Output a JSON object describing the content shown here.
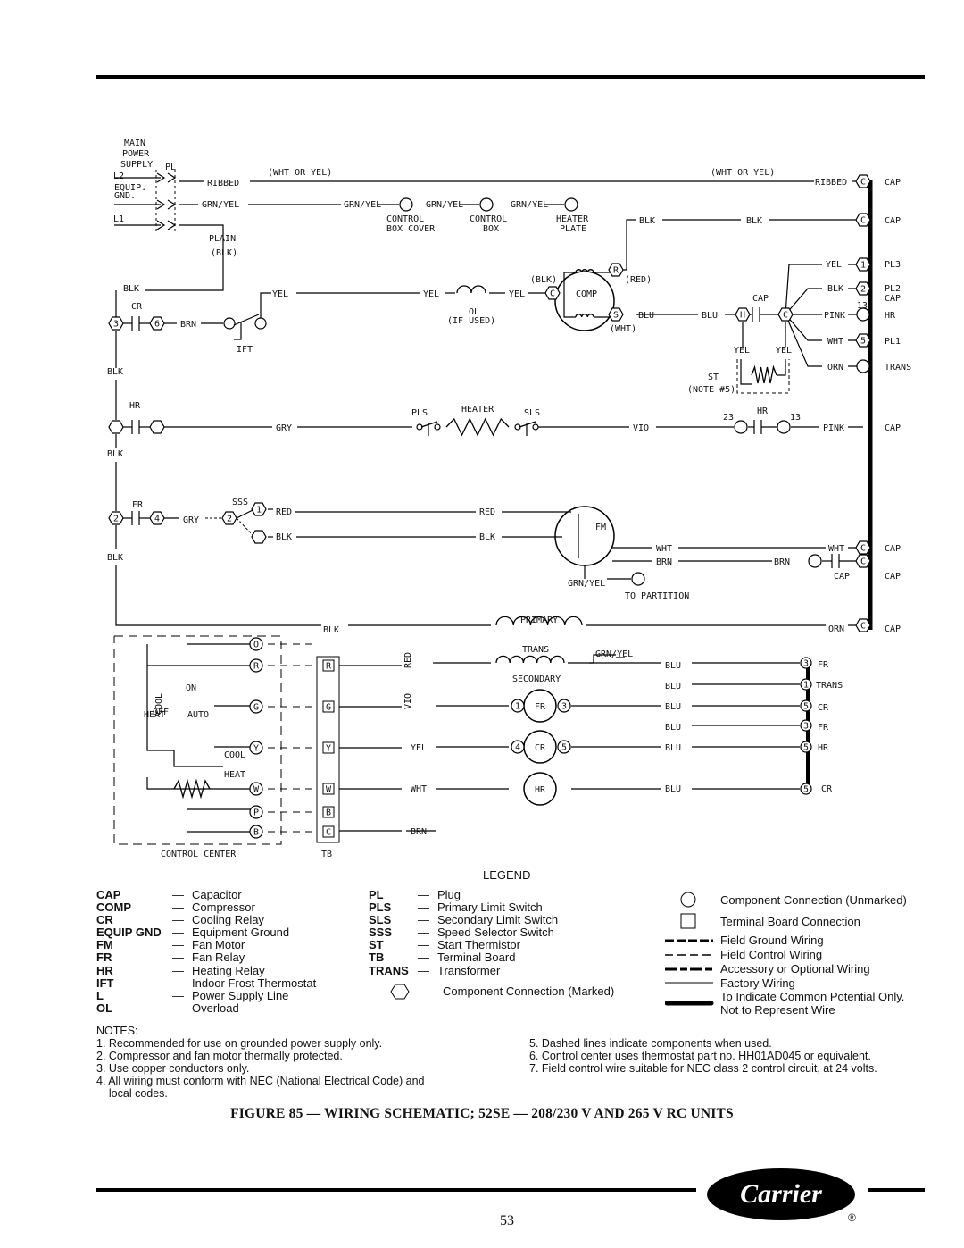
{
  "schematic": {
    "labels": [
      "MAIN",
      "POWER",
      "SUPPLY",
      "PL",
      "L2",
      "EQUIP.",
      "GND.",
      "L1",
      "RIBBED",
      "(WHT OR YEL)",
      "(WHT OR YEL)",
      "RIBBED",
      "CAP",
      "GRN/YEL",
      "GRN/YEL",
      "GRN/YEL",
      "GRN/YEL",
      "CONTROL",
      "BOX COVER",
      "CONTROL",
      "BOX",
      "HEATER",
      "PLATE",
      "BLK",
      "BLK",
      "CAP",
      "PLAIN",
      "(BLK)",
      "YEL",
      "PL3",
      "BLK",
      "PL2",
      "13",
      "PINK",
      "HR",
      "WHT",
      "PL1",
      "ORN",
      "TRANS",
      "(BLK)",
      "(RED)",
      "COMP",
      "BLU",
      "BLU",
      "CAP",
      "(WHT)",
      "OL",
      "(IF USED)",
      "YEL",
      "YEL",
      "YEL",
      "BLK",
      "CR",
      "BRN",
      "IFT",
      "BLK",
      "YEL",
      "YEL",
      "ST",
      "(NOTE #5)",
      "HR",
      "GRY",
      "PLS",
      "HEATER",
      "SLS",
      "VIO",
      "23",
      "HR",
      "13",
      "PINK",
      "CAP",
      "BLK",
      "FR",
      "SSS",
      "GRY",
      "RED",
      "BLK",
      "RED",
      "BLK",
      "FM",
      "WHT",
      "BRN",
      "WHT",
      "CAP",
      "BRN",
      "CAP",
      "BLK",
      "GRN/YEL",
      "TO PARTITION",
      "BLK",
      "PRIMARY",
      "ORN",
      "CAP",
      "GRN/YEL",
      "SECONDARY",
      "ON",
      "AUTO",
      "COOL",
      "HEAT",
      "HEAT",
      "OFF",
      "COOL",
      "RED",
      "VIO",
      "YEL",
      "WHT",
      "BRN",
      "BLU",
      "BLU",
      "BLU",
      "BLU",
      "BLU",
      "BLU",
      "FR",
      "TRANS",
      "CR",
      "FR",
      "HR",
      "CR",
      "CONTROL CENTER",
      "TB",
      "CAP",
      "CAP"
    ],
    "trans_label": "TRANS",
    "hex_marks": [
      "C",
      "C",
      "1",
      "2",
      "5",
      "3",
      "6",
      "R",
      "C",
      "S",
      "H",
      "C",
      "1",
      "2",
      "C",
      "C",
      "C",
      "2",
      "4",
      "3",
      "5"
    ],
    "terminal_marks": [
      "O",
      "R",
      "G",
      "Y",
      "W",
      "P",
      "B"
    ],
    "tb_marks": [
      "R",
      "G",
      "Y",
      "W",
      "B",
      "C"
    ],
    "relay_marks": [
      "FR",
      "CR",
      "HR"
    ],
    "relay_pins": [
      "1",
      "3",
      "4",
      "5"
    ],
    "right_pins": [
      "3",
      "1",
      "5",
      "3",
      "5",
      "5"
    ]
  },
  "legend": {
    "title": "LEGEND",
    "col1": [
      {
        "abbr": "CAP",
        "desc": "Capacitor"
      },
      {
        "abbr": "COMP",
        "desc": "Compressor"
      },
      {
        "abbr": "CR",
        "desc": "Cooling Relay"
      },
      {
        "abbr": "EQUIP GND",
        "desc": "Equipment Ground"
      },
      {
        "abbr": "FM",
        "desc": "Fan Motor"
      },
      {
        "abbr": "FR",
        "desc": "Fan Relay"
      },
      {
        "abbr": "HR",
        "desc": "Heating Relay"
      },
      {
        "abbr": "IFT",
        "desc": "Indoor Frost Thermostat"
      },
      {
        "abbr": "L",
        "desc": "Power Supply Line"
      },
      {
        "abbr": "OL",
        "desc": "Overload"
      }
    ],
    "col2": [
      {
        "abbr": "PL",
        "desc": "Plug"
      },
      {
        "abbr": "PLS",
        "desc": "Primary Limit Switch"
      },
      {
        "abbr": "SLS",
        "desc": "Secondary Limit Switch"
      },
      {
        "abbr": "SSS",
        "desc": "Speed Selector Switch"
      },
      {
        "abbr": "ST",
        "desc": "Start Thermistor"
      },
      {
        "abbr": "TB",
        "desc": "Terminal Board"
      },
      {
        "abbr": "TRANS",
        "desc": "Transformer"
      }
    ],
    "marked": "Component Connection (Marked)",
    "symbols": [
      "Component Connection (Unmarked)",
      "Terminal Board Connection",
      "Field Ground Wiring",
      "Field Control Wiring",
      "Accessory or Optional Wiring",
      "Factory Wiring",
      "To Indicate Common Potential Only.",
      "Not to Represent Wire"
    ]
  },
  "notes": {
    "title": "NOTES:",
    "left": [
      "1. Recommended for use on grounded power supply only.",
      "2. Compressor and fan motor thermally protected.",
      "3. Use copper conductors only.",
      "4. All wiring must conform with NEC (National Electrical Code) and",
      "    local codes."
    ],
    "right": [
      "5. Dashed lines indicate components when used.",
      "6. Control center uses thermostat part no. HH01AD045 or equivalent.",
      "7. Field control wire suitable for NEC class 2 control circuit, at 24 volts."
    ]
  },
  "caption": "FIGURE 85 — WIRING SCHEMATIC; 52SE — 208/230 V AND 265 V RC UNITS",
  "page_number": "53",
  "logo": "Carrier",
  "dash": "—"
}
